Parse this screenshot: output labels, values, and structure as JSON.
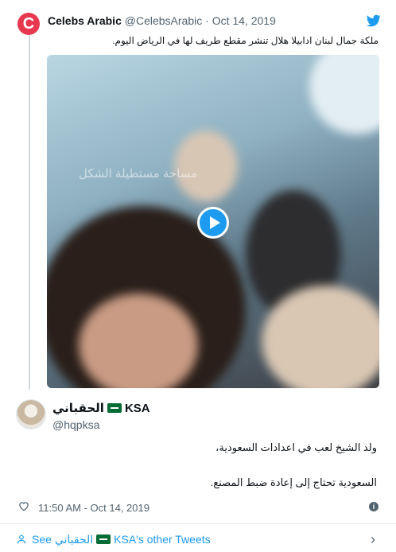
{
  "quoted": {
    "avatar_letter": "C",
    "name": "Celebs Arabic",
    "handle": "@CelebsArabic",
    "separator": "·",
    "date": "Oct 14, 2019",
    "text": "ملكة جمال لبنان ادابيلا هلال تنشر مقطع طريف لها في الرياض اليوم.",
    "video_watermark": "مساحة مستطيلة الشكل"
  },
  "author": {
    "name_ar": "الحقباني",
    "name_suffix": "KSA",
    "handle": "@hqpksa"
  },
  "tweet": {
    "line1": "ولد الشيخ لعب في اعدادات السعودية،",
    "line2": "السعودية تحتاج إلى إعادة ضبط المصنع."
  },
  "meta": {
    "time": "11:50 AM - Oct 14, 2019"
  },
  "footer": {
    "see_label": "See",
    "name_ar": "الحقباني",
    "other_label": "KSA's other Tweets"
  },
  "colors": {
    "accent": "#1d9bf0",
    "avatar_red": "#e8384f",
    "flag_green": "#006c35"
  },
  "icons": [
    "twitter-bird-icon",
    "play-icon",
    "heart-icon",
    "info-icon",
    "user-icon",
    "chevron-right-icon"
  ]
}
